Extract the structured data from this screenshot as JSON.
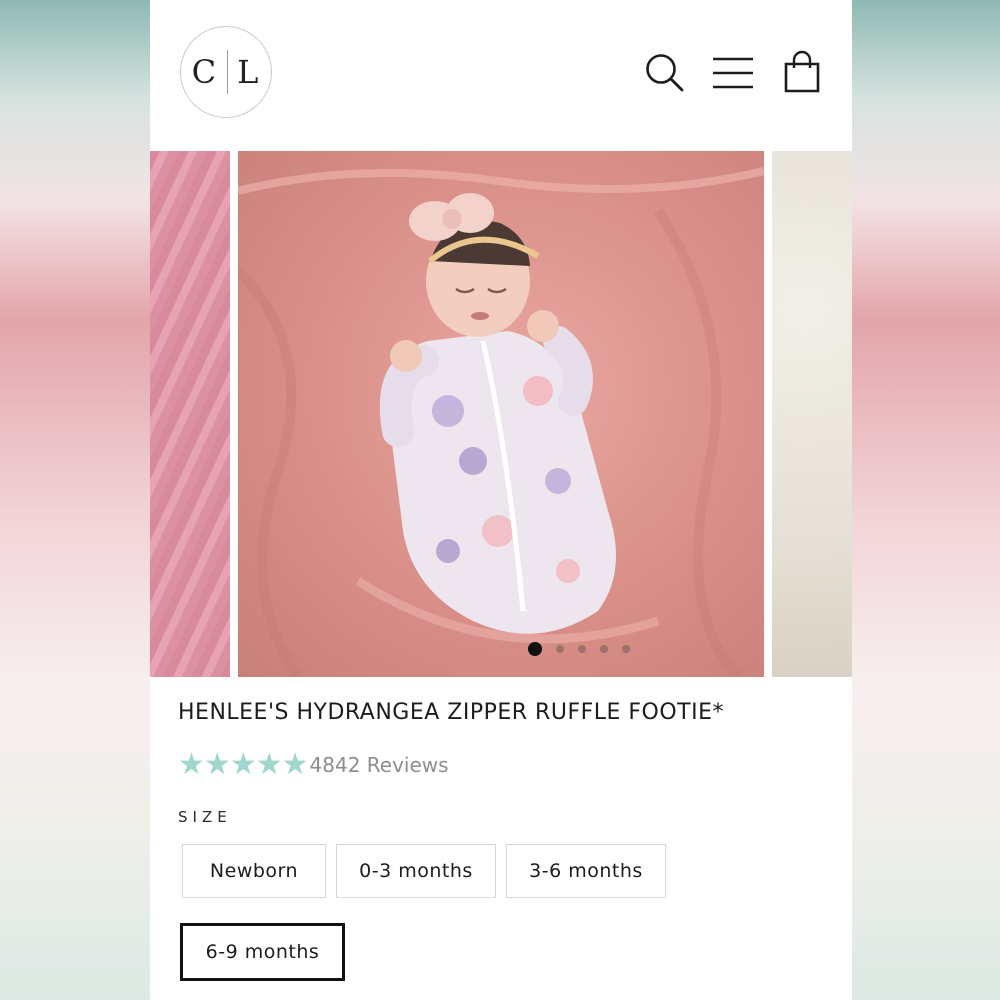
{
  "header": {
    "logo": {
      "left": "C",
      "right": "L"
    },
    "icons": [
      "search-icon",
      "menu-icon",
      "shopping-bag-icon"
    ]
  },
  "gallery": {
    "slide_count": 5,
    "active_index": 0
  },
  "product": {
    "title": "HENLEE'S HYDRANGEA ZIPPER RUFFLE FOOTIE*",
    "rating": {
      "stars": 5,
      "reviews_text": "4842 Reviews"
    },
    "size_label": "SIZE",
    "sizes": [
      {
        "label": "Newborn",
        "selected": false
      },
      {
        "label": "0-3 months",
        "selected": false
      },
      {
        "label": "3-6 months",
        "selected": false
      },
      {
        "label": "6-9 months",
        "selected": true
      }
    ]
  },
  "colors": {
    "star": "#9fd6cd",
    "text": "#1c1c1c",
    "selected_border": "#111111"
  }
}
